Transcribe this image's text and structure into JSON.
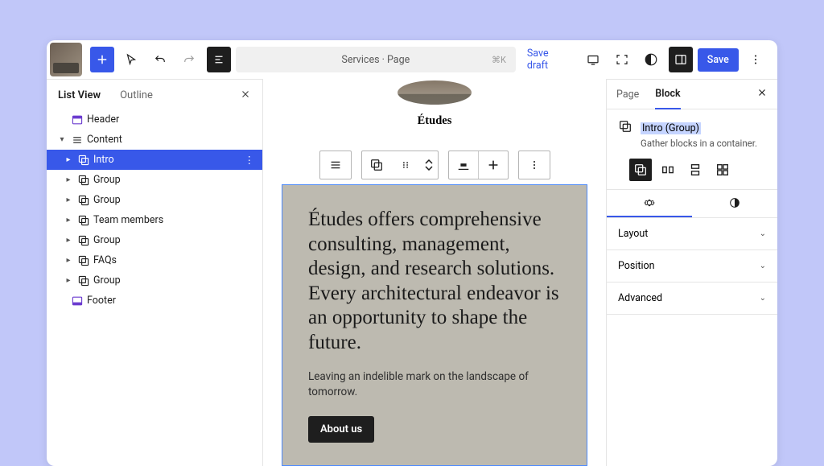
{
  "topbar": {
    "title": "Services · Page",
    "shortcut": "⌘K",
    "save_draft": "Save draft",
    "publish": "Save"
  },
  "left_panel": {
    "tabs": {
      "list_view": "List View",
      "outline": "Outline"
    },
    "tree": [
      {
        "label": "Header",
        "icon": "header",
        "level": 0
      },
      {
        "label": "Content",
        "icon": "content",
        "level": 0,
        "expanded": true
      },
      {
        "label": "Intro",
        "icon": "group",
        "level": 1,
        "selected": true
      },
      {
        "label": "Group",
        "icon": "group",
        "level": 1
      },
      {
        "label": "Group",
        "icon": "group",
        "level": 1
      },
      {
        "label": "Team members",
        "icon": "group",
        "level": 1
      },
      {
        "label": "Group",
        "icon": "group",
        "level": 1
      },
      {
        "label": "FAQs",
        "icon": "group",
        "level": 1
      },
      {
        "label": "Group",
        "icon": "group",
        "level": 1
      },
      {
        "label": "Footer",
        "icon": "footer",
        "level": 0
      }
    ]
  },
  "canvas": {
    "brand": "Études",
    "intro_heading": "Études offers comprehensive consulting, management, design, and research solutions. Every architectural endeavor is an opportunity to shape the future.",
    "intro_sub": "Leaving an indelible mark on the landscape of tomorrow.",
    "button": "About us"
  },
  "right_panel": {
    "tabs": {
      "page": "Page",
      "block": "Block"
    },
    "block_title": "Intro (Group)",
    "block_desc": "Gather blocks in a container.",
    "sections": {
      "layout": "Layout",
      "position": "Position",
      "advanced": "Advanced"
    }
  }
}
